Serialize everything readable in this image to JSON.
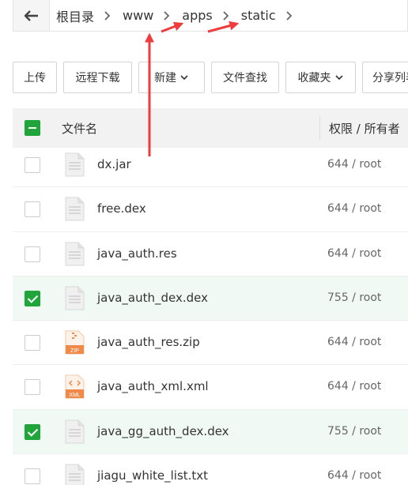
{
  "breadcrumb": {
    "items": [
      {
        "label": "根目录"
      },
      {
        "label": "www"
      },
      {
        "label": "apps"
      },
      {
        "label": "static"
      }
    ]
  },
  "toolbar": {
    "upload": "上传",
    "remote_download": "远程下载",
    "new": "新建",
    "file_search": "文件查找",
    "favorites": "收藏夹",
    "share_list": "分享列表"
  },
  "table": {
    "col_name": "文件名",
    "col_perm": "权限 / 所有者",
    "rows": [
      {
        "name": "dx.jar",
        "perm": "644 / root",
        "selected": false,
        "icon": "file-icon"
      },
      {
        "name": "free.dex",
        "perm": "644 / root",
        "selected": false,
        "icon": "file-icon"
      },
      {
        "name": "java_auth.res",
        "perm": "644 / root",
        "selected": false,
        "icon": "file-icon"
      },
      {
        "name": "java_auth_dex.dex",
        "perm": "755 / root",
        "selected": true,
        "icon": "file-icon"
      },
      {
        "name": "java_auth_res.zip",
        "perm": "644 / root",
        "selected": false,
        "icon": "zip-file-icon",
        "icon_text": "ZIP"
      },
      {
        "name": "java_auth_xml.xml",
        "perm": "644 / root",
        "selected": false,
        "icon": "xml-file-icon",
        "icon_text": "XML"
      },
      {
        "name": "java_gg_auth_dex.dex",
        "perm": "755 / root",
        "selected": true,
        "icon": "file-icon"
      },
      {
        "name": "jiagu_white_list.txt",
        "perm": "644 / root",
        "selected": false,
        "icon": "file-icon"
      }
    ]
  },
  "colors": {
    "accent": "#20a53a",
    "annotation": "#ef3b3b"
  }
}
